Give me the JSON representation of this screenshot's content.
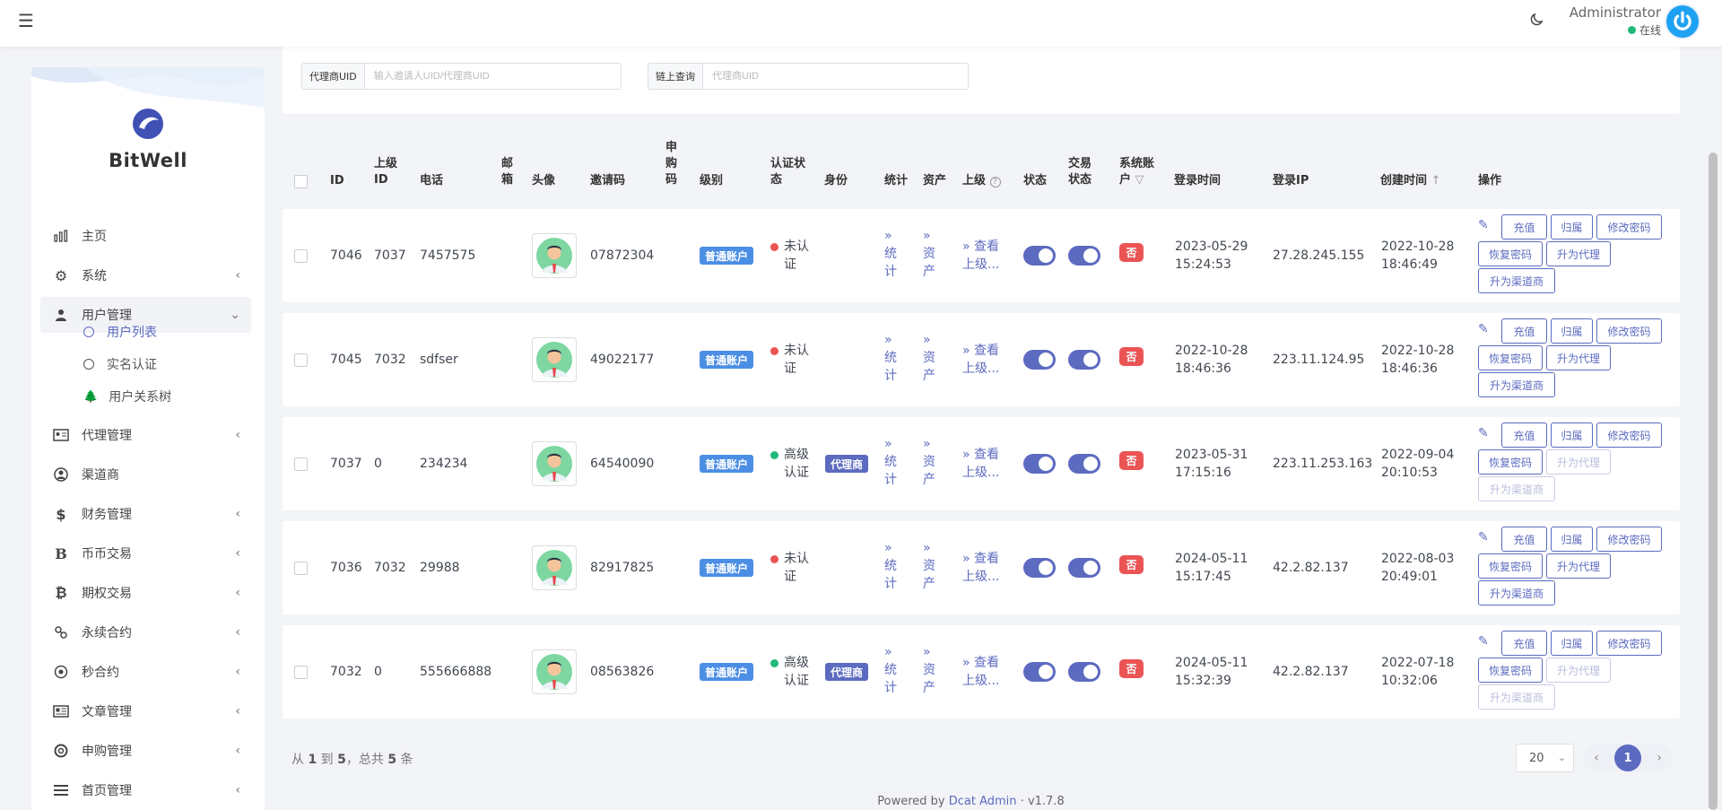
{
  "navbar": {
    "user_name": "Administrator",
    "user_status": "在线"
  },
  "brand": {
    "name": "BitWell"
  },
  "sidebar": {
    "items": [
      {
        "label": "主页",
        "icon": "bar-chart-icon",
        "has_children": false
      },
      {
        "label": "系统",
        "icon": "gear-icon",
        "has_children": true
      },
      {
        "label": "用户管理",
        "icon": "users-icon",
        "has_children": true,
        "expanded": true
      },
      {
        "label": "代理管理",
        "icon": "id-card-icon",
        "has_children": true
      },
      {
        "label": "渠道商",
        "icon": "user-circle-icon",
        "has_children": false
      },
      {
        "label": "财务管理",
        "icon": "dollar-icon",
        "has_children": true
      },
      {
        "label": "币币交易",
        "icon": "bold-b-icon",
        "has_children": true
      },
      {
        "label": "期权交易",
        "icon": "bitcoin-icon",
        "has_children": true
      },
      {
        "label": "永续合约",
        "icon": "link-icon",
        "has_children": true
      },
      {
        "label": "秒合约",
        "icon": "target-icon",
        "has_children": true
      },
      {
        "label": "文章管理",
        "icon": "newspaper-icon",
        "has_children": true
      },
      {
        "label": "申购管理",
        "icon": "lifebuoy-icon",
        "has_children": true
      },
      {
        "label": "首页管理",
        "icon": "list-icon",
        "has_children": true
      }
    ],
    "subitems": [
      {
        "label": "用户列表",
        "active": true
      },
      {
        "label": "实名认证",
        "active": false
      },
      {
        "label": "用户关系树",
        "active": false
      }
    ]
  },
  "filters": {
    "agent_uid": {
      "label": "代理商UID",
      "placeholder": "输入邀请人UID/代理商UID"
    },
    "chain_query": {
      "label": "链上查询",
      "placeholder": "代理商UID"
    }
  },
  "table": {
    "headers": {
      "id": "ID",
      "parent_id": "上级ID",
      "phone": "电话",
      "email": "邮箱",
      "avatar": "头像",
      "invite_code": "邀请码",
      "apply_code": "申购码",
      "level": "级别",
      "auth_status": "认证状态",
      "identity": "身份",
      "stats": "统计",
      "assets": "资产",
      "superior": "上级",
      "status": "状态",
      "trade_status": "交易状态",
      "system_account": "系统账户",
      "login_time": "登录时间",
      "login_ip": "登录IP",
      "created_time": "创建时间",
      "actions": "操作"
    },
    "rows": [
      {
        "id": "7046",
        "parent_id": "7037",
        "phone": "7457575",
        "invite_code": "07872304",
        "level": "普通账户",
        "auth_status": "未认证",
        "auth_color": "#ea5455",
        "identity": "",
        "stats": "统计",
        "assets": "资产",
        "superior": "查看上级...",
        "system_account": "否",
        "login_date": "2023-05-29",
        "login_time": "15:24:53",
        "login_ip": "27.28.245.155",
        "created_date": "2022-10-28",
        "created_time": "18:46:49",
        "is_agent": false
      },
      {
        "id": "7045",
        "parent_id": "7032",
        "phone": "sdfser",
        "invite_code": "49022177",
        "level": "普通账户",
        "auth_status": "未认证",
        "auth_color": "#ea5455",
        "identity": "",
        "stats": "统计",
        "assets": "资产",
        "superior": "查看上级...",
        "system_account": "否",
        "login_date": "2022-10-28",
        "login_time": "18:46:36",
        "login_ip": "223.11.124.95",
        "created_date": "2022-10-28",
        "created_time": "18:46:36",
        "is_agent": false
      },
      {
        "id": "7037",
        "parent_id": "0",
        "phone": "234234",
        "invite_code": "64540090",
        "level": "普通账户",
        "auth_status": "高级认证",
        "auth_color": "#21b978",
        "identity": "代理商",
        "stats": "统计",
        "assets": "资产",
        "superior": "查看上级...",
        "system_account": "否",
        "login_date": "2023-05-31",
        "login_time": "17:15:16",
        "login_ip": "223.11.253.163",
        "created_date": "2022-09-04",
        "created_time": "20:10:53",
        "is_agent": true
      },
      {
        "id": "7036",
        "parent_id": "7032",
        "phone": "29988",
        "invite_code": "82917825",
        "level": "普通账户",
        "auth_status": "未认证",
        "auth_color": "#ea5455",
        "identity": "",
        "stats": "统计",
        "assets": "资产",
        "superior": "查看上级...",
        "system_account": "否",
        "login_date": "2024-05-11",
        "login_time": "15:17:45",
        "login_ip": "42.2.82.137",
        "created_date": "2022-08-03",
        "created_time": "20:49:01",
        "is_agent": false
      },
      {
        "id": "7032",
        "parent_id": "0",
        "phone": "555666888",
        "invite_code": "08563826",
        "level": "普通账户",
        "auth_status": "高级认证",
        "auth_color": "#21b978",
        "identity": "代理商",
        "stats": "统计",
        "assets": "资产",
        "superior": "查看上级...",
        "system_account": "否",
        "login_date": "2024-05-11",
        "login_time": "15:32:39",
        "login_ip": "42.2.82.137",
        "created_date": "2022-07-18",
        "created_time": "10:32:06",
        "is_agent": true
      }
    ],
    "actions": {
      "recharge": "充值",
      "assign": "归属",
      "change_password": "修改密码",
      "reset_password": "恢复密码",
      "promote_agent": "升为代理",
      "promote_channel": "升为渠道商"
    }
  },
  "pagination": {
    "summary_prefix": "从",
    "from": "1",
    "to_word": "到",
    "to": "5",
    "total_word": "，总共",
    "total": "5",
    "unit": "条",
    "per_page": "20",
    "current_page": "1"
  },
  "footer": {
    "powered_prefix": "Powered by",
    "brand": "Dcat Admin",
    "version": "· v1.7.8"
  },
  "colors": {
    "accent": "#5c6bc0",
    "danger": "#ea5455",
    "success": "#21b978",
    "level_badge": "#4b8ee6"
  }
}
